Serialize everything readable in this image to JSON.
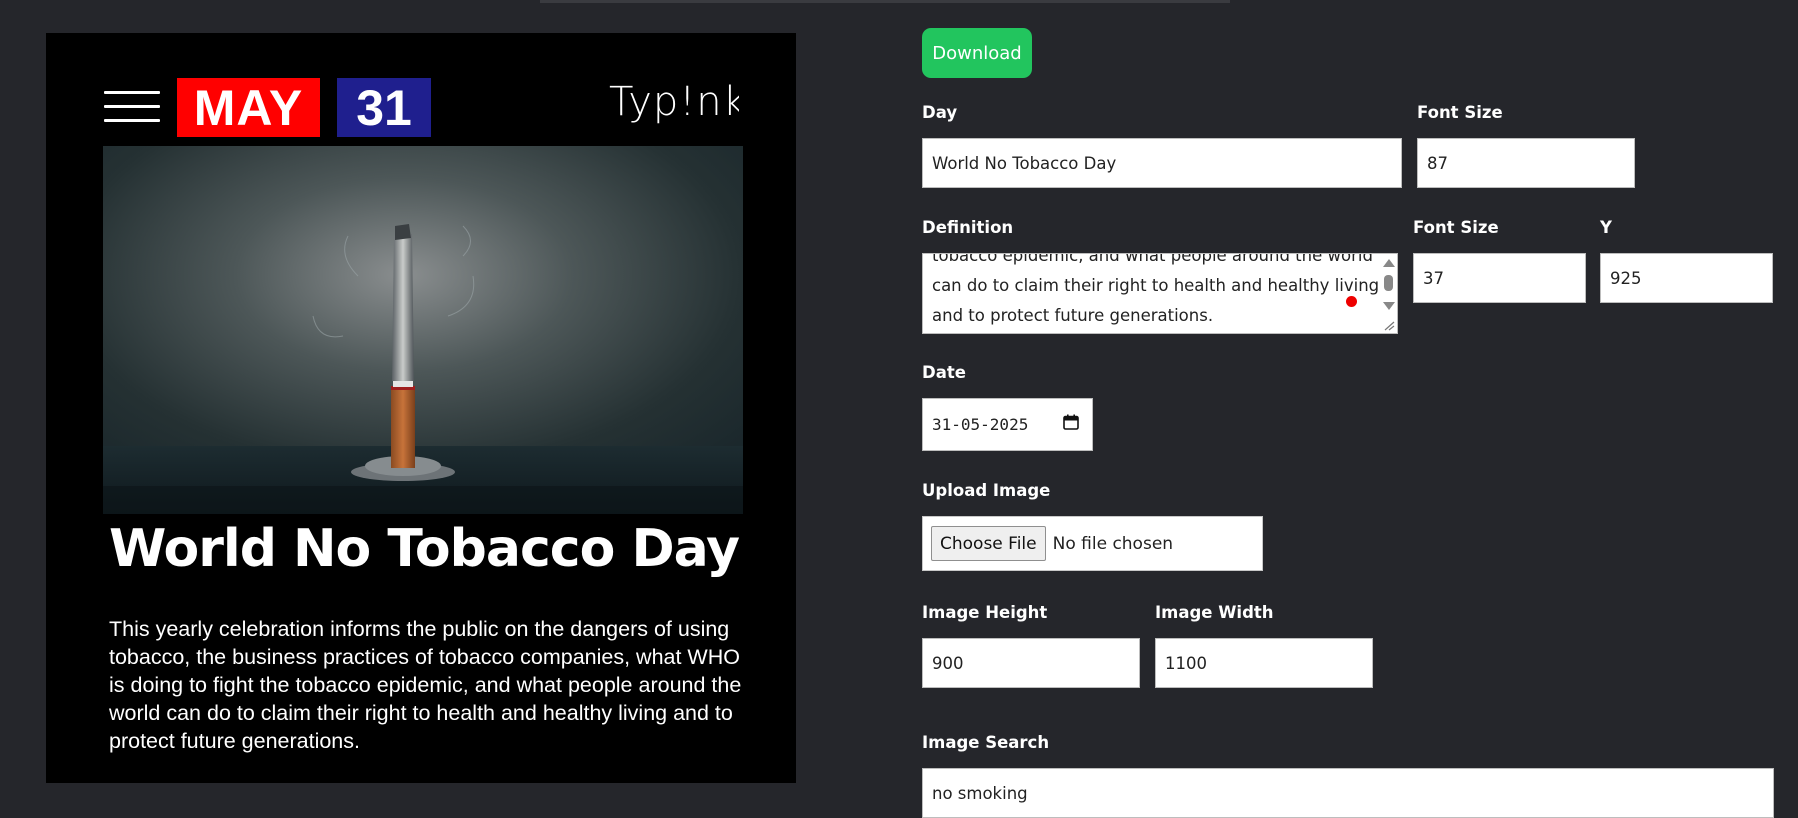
{
  "poster": {
    "month": "MAY",
    "day_number": "31",
    "logo": "Typ!nks",
    "title": "World No Tobacco Day",
    "definition": "This yearly celebration informs the public on the dangers of using tobacco, the business practices of tobacco companies, what WHO is doing to fight the tobacco epidemic, and what people around the world can do to claim their right to health and healthy living and to protect future generations.",
    "colors": {
      "month_badge": "#ff0000",
      "day_badge": "#1f1f8e",
      "background": "#000000"
    }
  },
  "form": {
    "download_label": "Download",
    "day": {
      "label": "Day",
      "value": "World No Tobacco Day"
    },
    "day_font_size": {
      "label": "Font Size",
      "value": "87"
    },
    "definition": {
      "label": "Definition",
      "visible_lines": [
        "tobacco epidemic, and what people around the world",
        "can do to claim their right to health and healthy living",
        "and to protect future generations."
      ]
    },
    "definition_font_size": {
      "label": "Font Size",
      "value": "37"
    },
    "definition_y": {
      "label": "Y",
      "value": "925"
    },
    "date": {
      "label": "Date",
      "value": "31-05-2025"
    },
    "upload_image": {
      "label": "Upload Image",
      "button": "Choose File",
      "status": "No file chosen"
    },
    "image_height": {
      "label": "Image Height",
      "value": "900"
    },
    "image_width": {
      "label": "Image Width",
      "value": "1100"
    },
    "image_search": {
      "label": "Image Search",
      "value": "no smoking"
    }
  },
  "colors": {
    "page_background": "#25262b",
    "download_button": "#22c55e"
  }
}
